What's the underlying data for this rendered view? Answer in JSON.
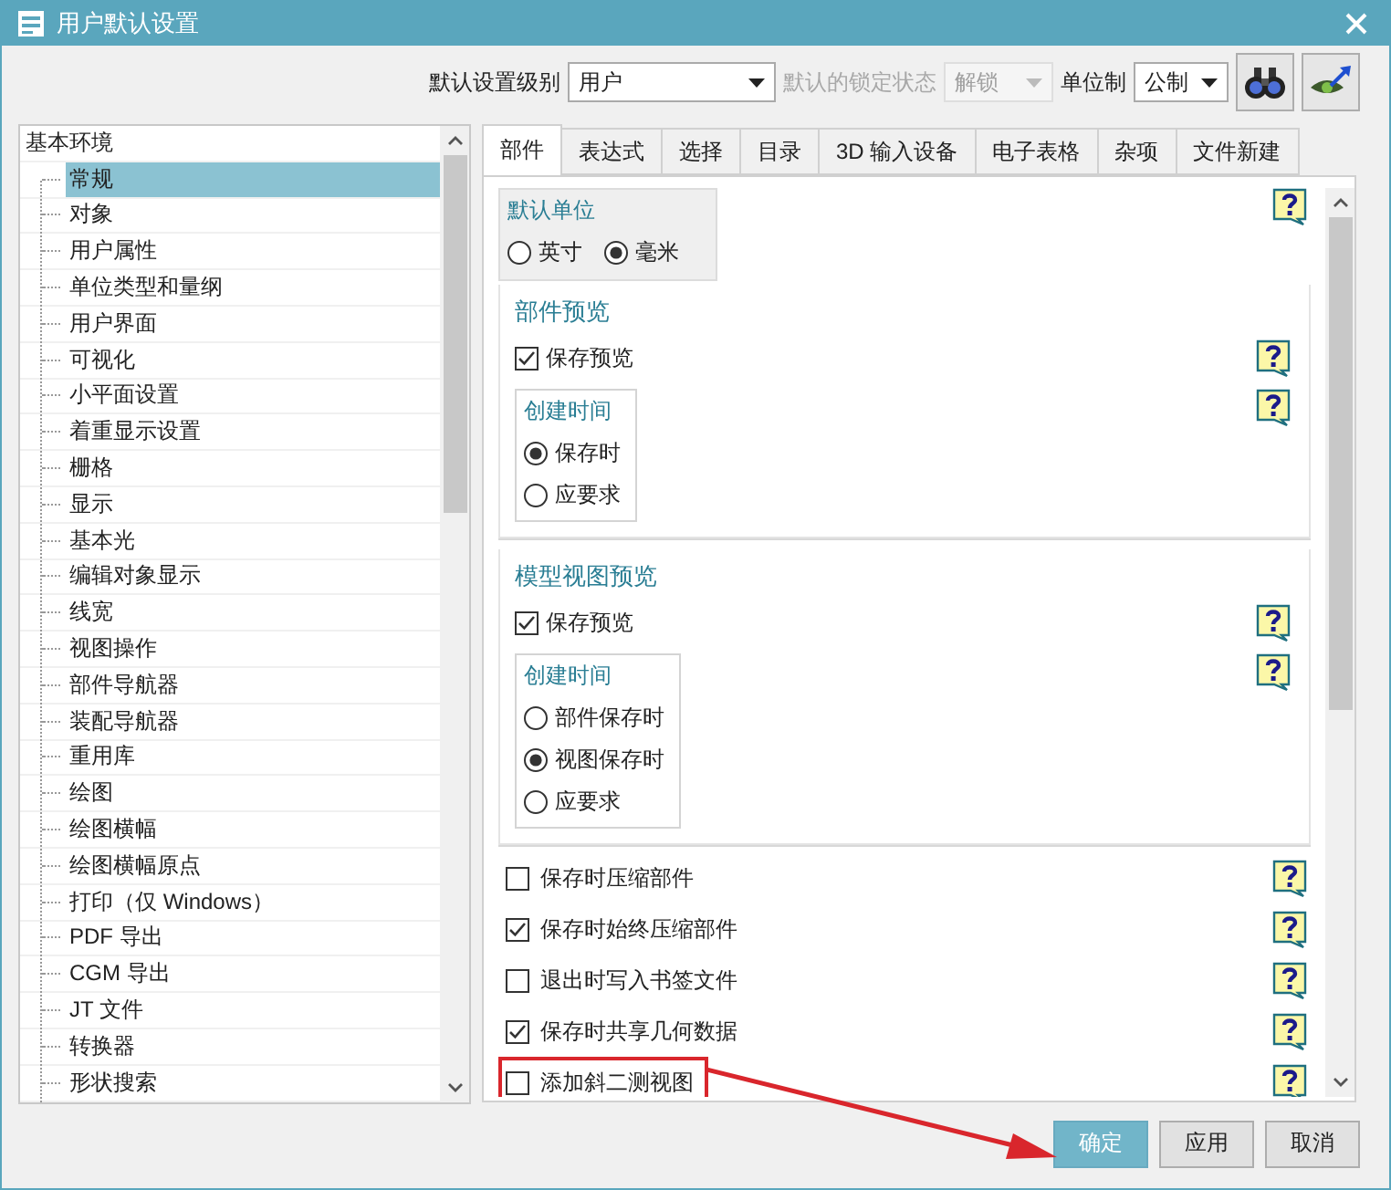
{
  "window": {
    "title": "用户默认设置"
  },
  "toolbar": {
    "level_label": "默认设置级别",
    "level_value": "用户",
    "lock_label": "默认的锁定状态",
    "lock_value": "解锁",
    "lock_disabled": true,
    "unit_label": "单位制",
    "unit_value": "公制"
  },
  "tree": {
    "label": "基本环境",
    "children": [
      {
        "label": "常规",
        "selected": true
      },
      {
        "label": "对象",
        "selected": false
      },
      {
        "label": "用户属性",
        "selected": false
      },
      {
        "label": "单位类型和量纲",
        "selected": false
      },
      {
        "label": "用户界面",
        "selected": false
      },
      {
        "label": "可视化",
        "selected": false
      },
      {
        "label": "小平面设置",
        "selected": false
      },
      {
        "label": "着重显示设置",
        "selected": false
      },
      {
        "label": "栅格",
        "selected": false
      },
      {
        "label": "显示",
        "selected": false
      },
      {
        "label": "基本光",
        "selected": false
      },
      {
        "label": "编辑对象显示",
        "selected": false
      },
      {
        "label": "线宽",
        "selected": false
      },
      {
        "label": "视图操作",
        "selected": false
      },
      {
        "label": "部件导航器",
        "selected": false
      },
      {
        "label": "装配导航器",
        "selected": false
      },
      {
        "label": "重用库",
        "selected": false
      },
      {
        "label": "绘图",
        "selected": false
      },
      {
        "label": "绘图横幅",
        "selected": false
      },
      {
        "label": "绘图横幅原点",
        "selected": false
      },
      {
        "label": "打印（仅 Windows）",
        "selected": false
      },
      {
        "label": "PDF 导出",
        "selected": false
      },
      {
        "label": "CGM 导出",
        "selected": false
      },
      {
        "label": "JT 文件",
        "selected": false
      },
      {
        "label": "转换器",
        "selected": false
      },
      {
        "label": "形状搜索",
        "selected": false
      }
    ]
  },
  "tabs": [
    {
      "label": "部件",
      "selected": true
    },
    {
      "label": "表达式",
      "selected": false
    },
    {
      "label": "选择",
      "selected": false
    },
    {
      "label": "目录",
      "selected": false
    },
    {
      "label": "3D 输入设备",
      "selected": false
    },
    {
      "label": "电子表格",
      "selected": false
    },
    {
      "label": "杂项",
      "selected": false
    },
    {
      "label": "文件新建",
      "selected": false
    }
  ],
  "unit_group": {
    "title": "默认单位",
    "options": [
      {
        "label": "英寸",
        "selected": false
      },
      {
        "label": "毫米",
        "selected": true
      }
    ]
  },
  "sections": [
    {
      "title": "部件预览",
      "checkbox": {
        "label": "保存预览",
        "checked": true
      },
      "group": {
        "title": "创建时间",
        "options": [
          {
            "label": "保存时",
            "selected": true
          },
          {
            "label": "应要求",
            "selected": false
          }
        ]
      }
    },
    {
      "title": "模型视图预览",
      "checkbox": {
        "label": "保存预览",
        "checked": true
      },
      "group": {
        "title": "创建时间",
        "options": [
          {
            "label": "部件保存时",
            "selected": false
          },
          {
            "label": "视图保存时",
            "selected": true
          },
          {
            "label": "应要求",
            "selected": false
          }
        ]
      }
    }
  ],
  "options": [
    {
      "label": "保存时压缩部件",
      "checked": false,
      "highlighted": false
    },
    {
      "label": "保存时始终压缩部件",
      "checked": true,
      "highlighted": false
    },
    {
      "label": "退出时写入书签文件",
      "checked": false,
      "highlighted": false
    },
    {
      "label": "保存时共享几何数据",
      "checked": true,
      "highlighted": false
    },
    {
      "label": "添加斜二测视图",
      "checked": false,
      "highlighted": true
    }
  ],
  "buttons": [
    {
      "label": "确定",
      "kind": "primary"
    },
    {
      "label": "应用",
      "kind": "normal"
    },
    {
      "label": "取消",
      "kind": "normal"
    }
  ]
}
